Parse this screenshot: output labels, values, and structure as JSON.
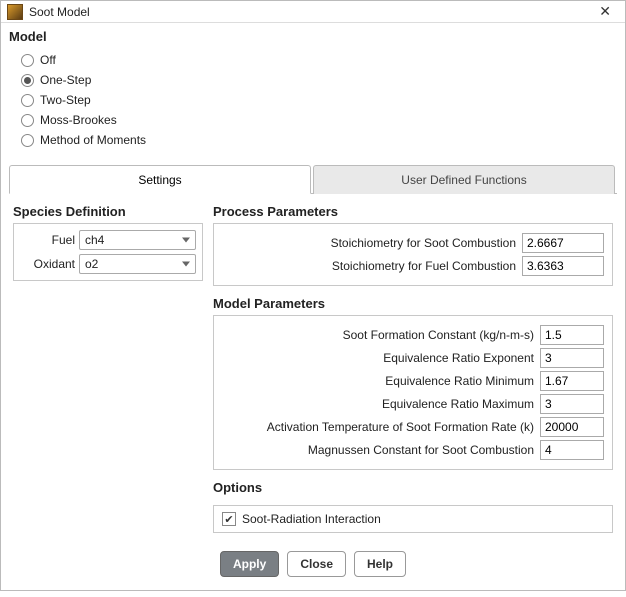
{
  "window": {
    "title": "Soot Model"
  },
  "model": {
    "heading": "Model",
    "options": [
      "Off",
      "One-Step",
      "Two-Step",
      "Moss-Brookes",
      "Method of Moments"
    ],
    "selected_index": 1
  },
  "tabs": {
    "settings": "Settings",
    "udf": "User Defined Functions",
    "active": "settings"
  },
  "species": {
    "heading": "Species Definition",
    "fuel_label": "Fuel",
    "fuel_value": "ch4",
    "oxidant_label": "Oxidant",
    "oxidant_value": "o2"
  },
  "process": {
    "heading": "Process Parameters",
    "soot_stoich_label": "Stoichiometry for Soot Combustion",
    "soot_stoich_value": "2.6667",
    "fuel_stoich_label": "Stoichiometry for Fuel Combustion",
    "fuel_stoich_value": "3.6363"
  },
  "model_params": {
    "heading": "Model Parameters",
    "sfc_label": "Soot Formation Constant (kg/n-m-s)",
    "sfc_value": "1.5",
    "ere_label": "Equivalence Ratio Exponent",
    "ere_value": "3",
    "ermin_label": "Equivalence Ratio Minimum",
    "ermin_value": "1.67",
    "ermax_label": "Equivalence Ratio Maximum",
    "ermax_value": "3",
    "atemp_label": "Activation Temperature of Soot Formation Rate (k)",
    "atemp_value": "20000",
    "magnussen_label": "Magnussen Constant for Soot Combustion",
    "magnussen_value": "4"
  },
  "options": {
    "heading": "Options",
    "soot_radiation_label": "Soot-Radiation Interaction",
    "soot_radiation_checked": true
  },
  "buttons": {
    "apply": "Apply",
    "close": "Close",
    "help": "Help"
  }
}
